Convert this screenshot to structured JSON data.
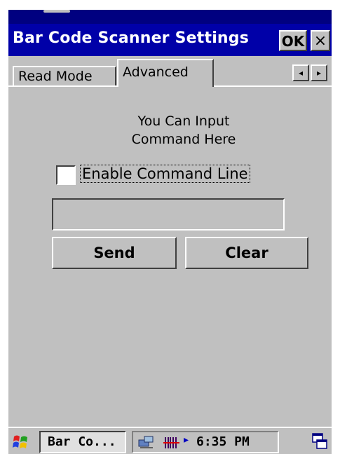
{
  "window": {
    "title": "Bar Code Scanner Settings",
    "ok_label": "OK",
    "close_label": "×"
  },
  "tabs": [
    {
      "label": "Read Mode",
      "selected": false
    },
    {
      "label": "Advanced",
      "selected": true
    }
  ],
  "tab_scroll": {
    "left": "◂",
    "right": "▸"
  },
  "panel": {
    "instruction_line1": "You Can Input",
    "instruction_line2": "Command Here",
    "enable_label": "Enable Command Line",
    "enable_checked": false,
    "command_value": "",
    "send_label": "Send",
    "clear_label": "Clear"
  },
  "taskbar": {
    "start_icon": "windows-flag-icon",
    "app_label": "Bar Co...",
    "tray_arrow": "▸",
    "time": "6:35 PM",
    "icons": [
      "network-icon",
      "barcode-icon",
      "desktop-icon"
    ]
  },
  "colors": {
    "title_bar": "#0000a8",
    "face": "#c0c0c0"
  }
}
